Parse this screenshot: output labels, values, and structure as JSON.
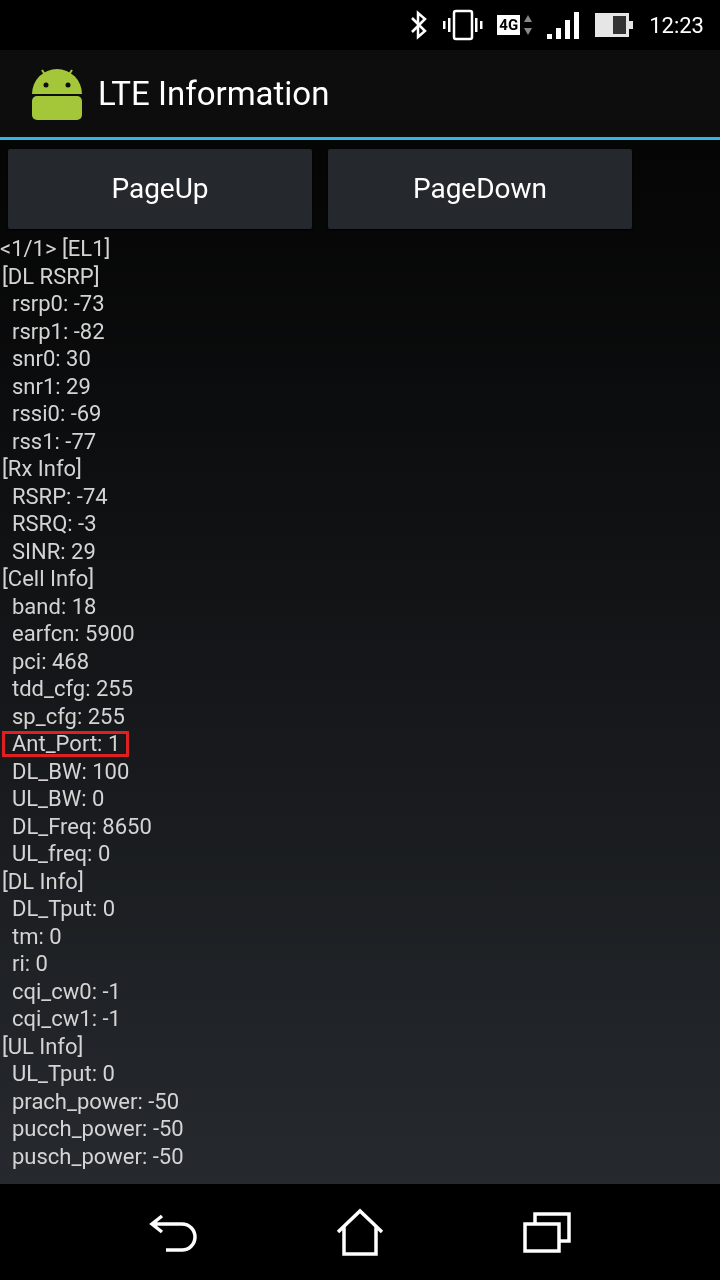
{
  "status_bar": {
    "network": "4G",
    "time": "12:23"
  },
  "action_bar": {
    "title": "LTE Information"
  },
  "buttons": [
    "PageUp",
    "PageDown"
  ],
  "page_header": "<1/1> [EL1]",
  "sections": [
    {
      "title": "[DL RSRP]",
      "items": [
        {
          "text": "rsrp0: -73",
          "highlighted": false
        },
        {
          "text": "rsrp1: -82",
          "highlighted": false
        },
        {
          "text": "snr0: 30",
          "highlighted": false
        },
        {
          "text": "snr1: 29",
          "highlighted": false
        },
        {
          "text": "rssi0: -69",
          "highlighted": false
        },
        {
          "text": "rss1: -77",
          "highlighted": false
        }
      ]
    },
    {
      "title": "[Rx Info]",
      "items": [
        {
          "text": "RSRP: -74",
          "highlighted": false
        },
        {
          "text": "RSRQ: -3",
          "highlighted": false
        },
        {
          "text": "SINR: 29",
          "highlighted": false
        }
      ]
    },
    {
      "title": "[Cell Info]",
      "items": [
        {
          "text": "band: 18",
          "highlighted": false
        },
        {
          "text": "earfcn: 5900",
          "highlighted": false
        },
        {
          "text": "pci: 468",
          "highlighted": false
        },
        {
          "text": "tdd_cfg: 255",
          "highlighted": false
        },
        {
          "text": "sp_cfg: 255",
          "highlighted": false
        },
        {
          "text": "Ant_Port: 1",
          "highlighted": true
        },
        {
          "text": "DL_BW: 100",
          "highlighted": false
        },
        {
          "text": "UL_BW: 0",
          "highlighted": false
        },
        {
          "text": "DL_Freq: 8650",
          "highlighted": false
        },
        {
          "text": "UL_freq: 0",
          "highlighted": false
        }
      ]
    },
    {
      "title": "[DL Info]",
      "items": [
        {
          "text": "DL_Tput: 0",
          "highlighted": false
        },
        {
          "text": "tm: 0",
          "highlighted": false
        },
        {
          "text": "ri: 0",
          "highlighted": false
        },
        {
          "text": "cqi_cw0: -1",
          "highlighted": false
        },
        {
          "text": "cqi_cw1: -1",
          "highlighted": false
        }
      ]
    },
    {
      "title": "[UL Info]",
      "items": [
        {
          "text": "UL_Tput: 0",
          "highlighted": false
        },
        {
          "text": "prach_power: -50",
          "highlighted": false
        },
        {
          "text": "pucch_power: -50",
          "highlighted": false
        },
        {
          "text": "pusch_power: -50",
          "highlighted": false
        }
      ]
    }
  ]
}
